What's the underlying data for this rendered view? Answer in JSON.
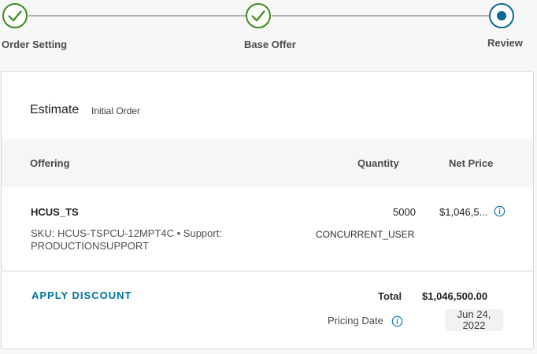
{
  "stepper": {
    "steps": [
      {
        "label": "Order Setting",
        "state": "complete"
      },
      {
        "label": "Base Offer",
        "state": "complete"
      },
      {
        "label": "Review",
        "state": "current"
      }
    ],
    "colors": {
      "complete": "#3d8a1e",
      "current": "#0a6a93",
      "line": "#b0b0b0"
    }
  },
  "estimate": {
    "title": "Estimate",
    "subtitle": "Initial Order"
  },
  "table": {
    "headers": {
      "offering": "Offering",
      "quantity": "Quantity",
      "net_price": "Net Price"
    },
    "rows": [
      {
        "name": "HCUS_TS",
        "sku": "SKU: HCUS-TSPCU-12MPT4C • Support: PRODUCTIONSUPPORT",
        "quantity": "5000",
        "unit": "CONCURRENT_USER",
        "net_price": "$1,046,5..."
      }
    ]
  },
  "footer": {
    "apply_discount": "APPLY DISCOUNT",
    "total_label": "Total",
    "total_value": "$1,046,500.00",
    "pricing_date_label": "Pricing Date",
    "pricing_date_value": "Jun 24, 2022"
  },
  "icons": {
    "step_complete": "check-circle-icon",
    "step_current": "dot-circle-icon",
    "info": "info-circle-icon"
  },
  "colors": {
    "link": "#0072a3",
    "info": "#0072a3"
  }
}
